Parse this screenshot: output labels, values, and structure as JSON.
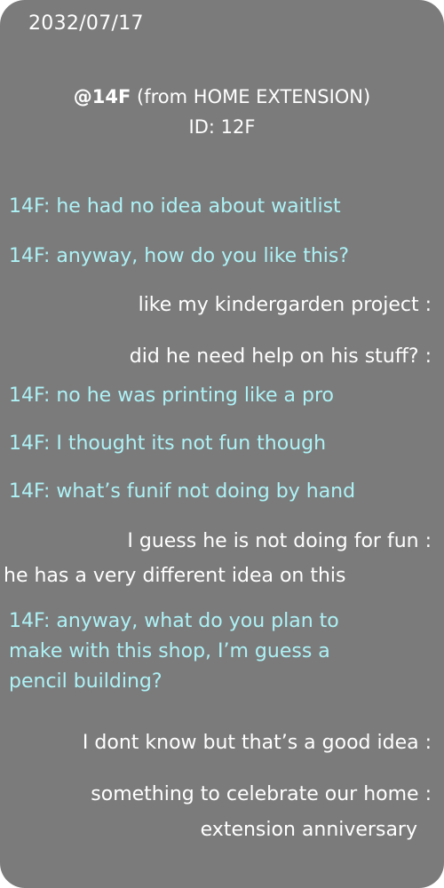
{
  "date": "2032/07/17",
  "header": {
    "handle": "@14F",
    "source": " (from HOME EXTENSION)",
    "id_line": "ID: 12F"
  },
  "messages": [
    {
      "text": "14F: he had no idea about waitlist"
    },
    {
      "text": "14F: anyway, how do you like this?"
    },
    {
      "text": "like my kindergarden project  :"
    },
    {
      "text": "did he need help on his stuff?  :"
    },
    {
      "text": "14F: no he was printing like a pro"
    },
    {
      "text": "14F: I thought its not fun though"
    },
    {
      "text": "14F: what’s funif not doing by hand"
    },
    {
      "text": "I guess he is not doing for fun :"
    },
    {
      "text": "he has a very different idea on this"
    },
    {
      "text": "14F: anyway, what do you plan to"
    },
    {
      "text": "make with this shop, I’m guess a"
    },
    {
      "text": "pencil building?"
    },
    {
      "text": "I dont know but that’s a good idea :"
    },
    {
      "text": "something to celebrate our home :"
    },
    {
      "text": "extension anniversary"
    }
  ],
  "colors": {
    "panel_background": "#7b7b7b",
    "other_user_text": "#aef2f6",
    "self_text": "#ffffff"
  }
}
